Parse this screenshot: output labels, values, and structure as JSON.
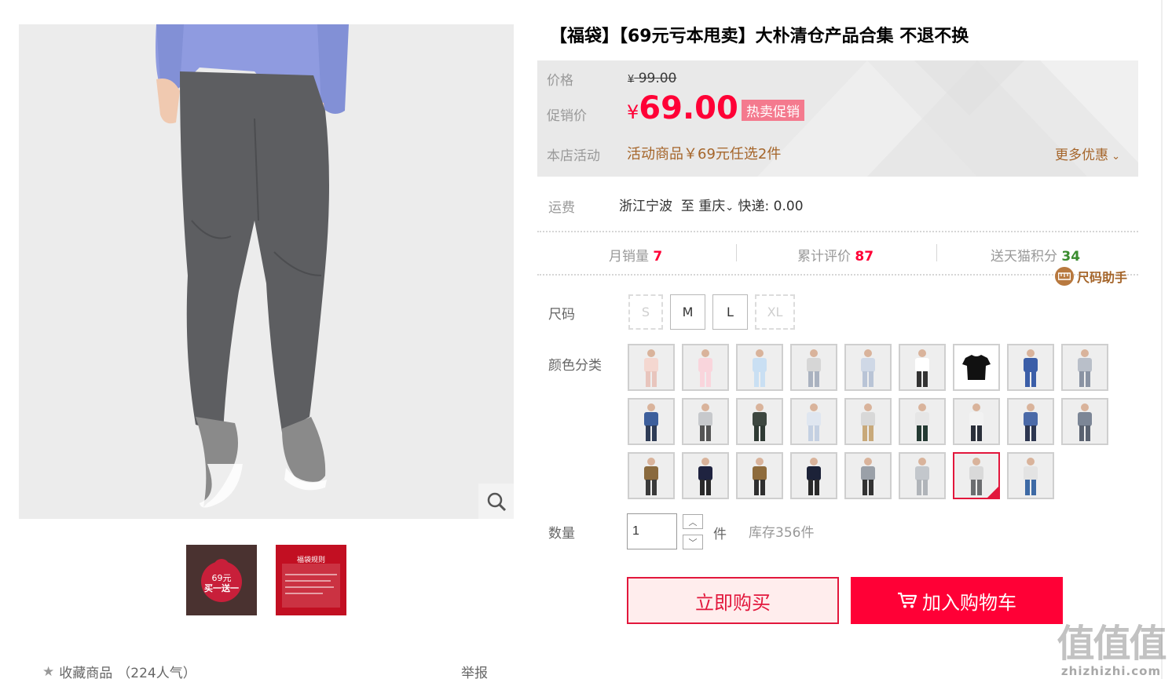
{
  "product": {
    "title": "【福袋】【69元亏本甩卖】大朴清仓产品合集 不退不换"
  },
  "price_panel": {
    "price_label": "价格",
    "original_currency": "¥",
    "original_price": "99.00",
    "promo_label": "促销价",
    "promo_currency": "¥",
    "promo_price": "69.00",
    "hot_tag": "热卖促销",
    "activity_label": "本店活动",
    "activity_text": "活动商品￥69元任选2件",
    "more_offers": "更多优惠"
  },
  "shipping": {
    "label": "运费",
    "from": "浙江宁波",
    "to_prefix": "至",
    "to": "重庆",
    "express": "快递: 0.00"
  },
  "stats": {
    "monthly_sales_label": "月销量",
    "monthly_sales": "7",
    "reviews_label": "累计评价",
    "reviews": "87",
    "points_label": "送天猫积分",
    "points": "34"
  },
  "size_helper": "尺码助手",
  "size": {
    "label": "尺码",
    "options": [
      "S",
      "M",
      "L",
      "XL"
    ],
    "disabled": [
      "S",
      "XL"
    ]
  },
  "color": {
    "label": "颜色分类",
    "swatch_count": 26,
    "selected_index": 24
  },
  "quantity": {
    "label": "数量",
    "value": "1",
    "unit": "件",
    "stock": "库存356件"
  },
  "actions": {
    "buy_now": "立即购买",
    "add_to_cart": "加入购物车"
  },
  "gallery": {
    "thumb2_title": "福袋规则",
    "thumb1_price": "69元",
    "thumb1_offer": "买一送一"
  },
  "footer": {
    "favorite": "收藏商品",
    "favorite_count": "（224人气）",
    "report": "举报"
  },
  "watermark": {
    "logo": "值值值",
    "url": "zhizhizhi.com"
  },
  "colors": {
    "accent": "#ff0036",
    "accent_dark": "#e2173c",
    "promo_tag": "#f47a8e",
    "activity": "#a5652a",
    "points_green": "#3a8c2f"
  }
}
